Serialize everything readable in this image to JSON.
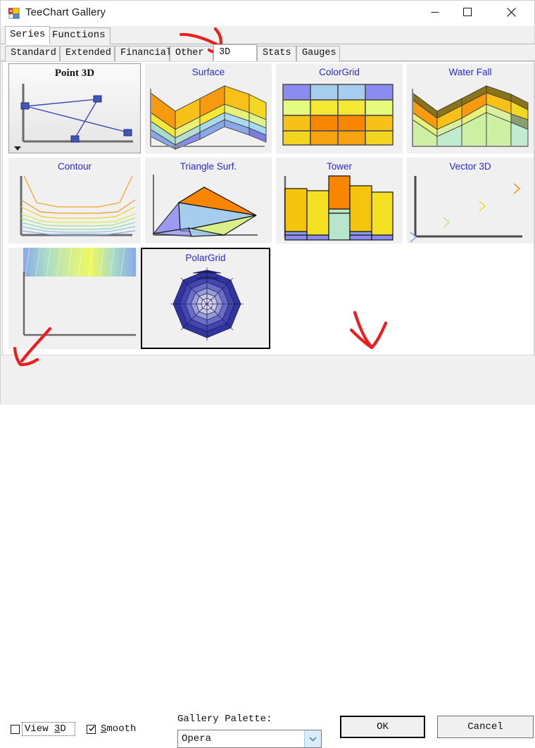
{
  "window": {
    "title": "TeeChart Gallery",
    "icon": "app-icon",
    "controls": {
      "minimize": "minimize-icon",
      "maximize": "maximize-icon",
      "close": "close-icon"
    }
  },
  "primary_tabs": {
    "items": [
      {
        "label": "Series",
        "selected": true
      },
      {
        "label": "Functions",
        "selected": false
      }
    ]
  },
  "secondary_tabs": {
    "items": [
      {
        "label": "Standard",
        "selected": false
      },
      {
        "label": "Extended",
        "selected": false
      },
      {
        "label": "Financial",
        "selected": false
      },
      {
        "label": "Other",
        "selected": false
      },
      {
        "label": "3D",
        "selected": true
      },
      {
        "label": "Stats",
        "selected": false
      },
      {
        "label": "Gauges",
        "selected": false
      }
    ]
  },
  "gallery": {
    "items": [
      {
        "label": "Point 3D",
        "state": "selected"
      },
      {
        "label": "Surface",
        "state": "normal"
      },
      {
        "label": "ColorGrid",
        "state": "normal"
      },
      {
        "label": "Water Fall",
        "state": "normal"
      },
      {
        "label": "Contour",
        "state": "normal"
      },
      {
        "label": "Triangle Surf.",
        "state": "normal"
      },
      {
        "label": "Tower",
        "state": "normal"
      },
      {
        "label": "Vector 3D",
        "state": "normal"
      },
      {
        "label": "",
        "state": "clipped"
      },
      {
        "label": "PolarGrid",
        "state": "focused"
      }
    ],
    "scroll_arrow": "scroll-down-arrow"
  },
  "options": {
    "view3d": {
      "label": "View 3D",
      "mnemonic": "3",
      "checked": false,
      "focused": true
    },
    "smooth": {
      "label": "Smooth",
      "mnemonic": "S",
      "checked": true,
      "focused": false
    }
  },
  "palette": {
    "label": "Gallery Palette:",
    "value": "Opera",
    "dropdown_icon": "chevron-down-icon"
  },
  "buttons": {
    "ok": "OK",
    "cancel": "Cancel"
  },
  "annotations": {
    "color": "#ef1c1c",
    "marks": [
      "arrow-to-3d-tab",
      "arrow-to-view3d-checkbox",
      "arrow-to-ok-button"
    ]
  },
  "colors": {
    "caption": "#2a2ad0",
    "window_bg": "#f0f0f0",
    "panel_bg": "#ffffff",
    "accent_red": "#ef1c1c"
  }
}
